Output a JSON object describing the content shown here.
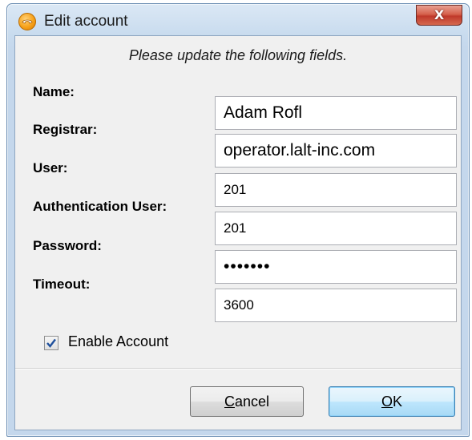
{
  "window": {
    "title": "Edit account",
    "close_glyph": "X",
    "app_icon": "phone-app-icon"
  },
  "form": {
    "instruction": "Please update the following fields.",
    "fields": [
      {
        "label": "Name:",
        "value": "Adam Rofl"
      },
      {
        "label": "Registrar:",
        "value": "operator.lalt-inc.com"
      },
      {
        "label": "User:",
        "value": "201"
      },
      {
        "label": "Authentication User:",
        "value": "201"
      },
      {
        "label": "Password:",
        "value": "•••••••"
      },
      {
        "label": "Timeout:",
        "value": "3600"
      }
    ],
    "enable_account": {
      "label": "Enable Account",
      "checked": true
    }
  },
  "buttons": {
    "cancel": {
      "mnemonic": "C",
      "rest": "ancel"
    },
    "ok": {
      "mnemonic": "O",
      "rest": "K"
    }
  },
  "colors": {
    "titlebar": "#c4d7ec",
    "close_button": "#c0392b",
    "default_button_border": "#3c7fb1",
    "checkmark": "#1e4f9c"
  }
}
